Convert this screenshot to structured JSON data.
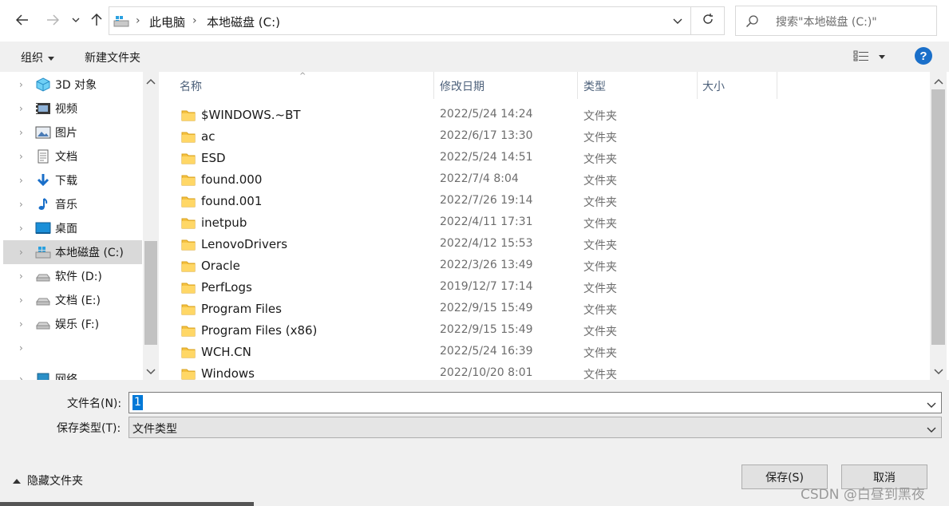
{
  "address_bar": {
    "breadcrumbs": [
      "此电脑",
      "本地磁盘 (C:)"
    ],
    "search_placeholder": "搜索\"本地磁盘 (C:)\""
  },
  "toolbar": {
    "organize_label": "组织",
    "new_folder_label": "新建文件夹",
    "help_label": "?"
  },
  "nav_pane": {
    "items": [
      {
        "label": "3D 对象",
        "icon": "3d-objects-icon"
      },
      {
        "label": "视频",
        "icon": "video-icon"
      },
      {
        "label": "图片",
        "icon": "pictures-icon"
      },
      {
        "label": "文档",
        "icon": "documents-icon"
      },
      {
        "label": "下载",
        "icon": "download-icon"
      },
      {
        "label": "音乐",
        "icon": "music-icon"
      },
      {
        "label": "桌面",
        "icon": "desktop-icon"
      },
      {
        "label": "本地磁盘 (C:)",
        "icon": "local-disk-icon",
        "selected": true
      },
      {
        "label": "软件 (D:)",
        "icon": "drive-icon"
      },
      {
        "label": "文档 (E:)",
        "icon": "drive-icon"
      },
      {
        "label": "娱乐 (F:)",
        "icon": "drive-icon"
      },
      {
        "label": "网络",
        "icon": "network-icon"
      }
    ]
  },
  "file_list": {
    "columns": [
      "名称",
      "修改日期",
      "类型",
      "大小"
    ],
    "rows": [
      {
        "name": "$WINDOWS.~BT",
        "date": "2022/5/24 14:24",
        "type": "文件夹"
      },
      {
        "name": "ac",
        "date": "2022/6/17 13:30",
        "type": "文件夹"
      },
      {
        "name": "ESD",
        "date": "2022/5/24 14:51",
        "type": "文件夹"
      },
      {
        "name": "found.000",
        "date": "2022/7/4 8:04",
        "type": "文件夹"
      },
      {
        "name": "found.001",
        "date": "2022/7/26 19:14",
        "type": "文件夹"
      },
      {
        "name": "inetpub",
        "date": "2022/4/11 17:31",
        "type": "文件夹"
      },
      {
        "name": "LenovoDrivers",
        "date": "2022/4/12 15:53",
        "type": "文件夹"
      },
      {
        "name": "Oracle",
        "date": "2022/3/26 13:49",
        "type": "文件夹"
      },
      {
        "name": "PerfLogs",
        "date": "2019/12/7 17:14",
        "type": "文件夹"
      },
      {
        "name": "Program Files",
        "date": "2022/9/15 15:49",
        "type": "文件夹"
      },
      {
        "name": "Program Files (x86)",
        "date": "2022/9/15 15:49",
        "type": "文件夹"
      },
      {
        "name": "WCH.CN",
        "date": "2022/5/24 16:39",
        "type": "文件夹"
      },
      {
        "name": "Windows",
        "date": "2022/10/20 8:01",
        "type": "文件夹"
      }
    ]
  },
  "form": {
    "filename_label": "文件名(N):",
    "filename_value": "1",
    "filetype_label": "保存类型(T):",
    "filetype_value": "文件类型"
  },
  "footer": {
    "hide_folders_label": "隐藏文件夹",
    "save_label": "保存(S)",
    "cancel_label": "取消",
    "watermark": "CSDN @白昼到黑夜"
  },
  "colors": {
    "accent": "#0078d7",
    "folder": "#f5c242",
    "selected_nav": "#d9d9d9"
  }
}
